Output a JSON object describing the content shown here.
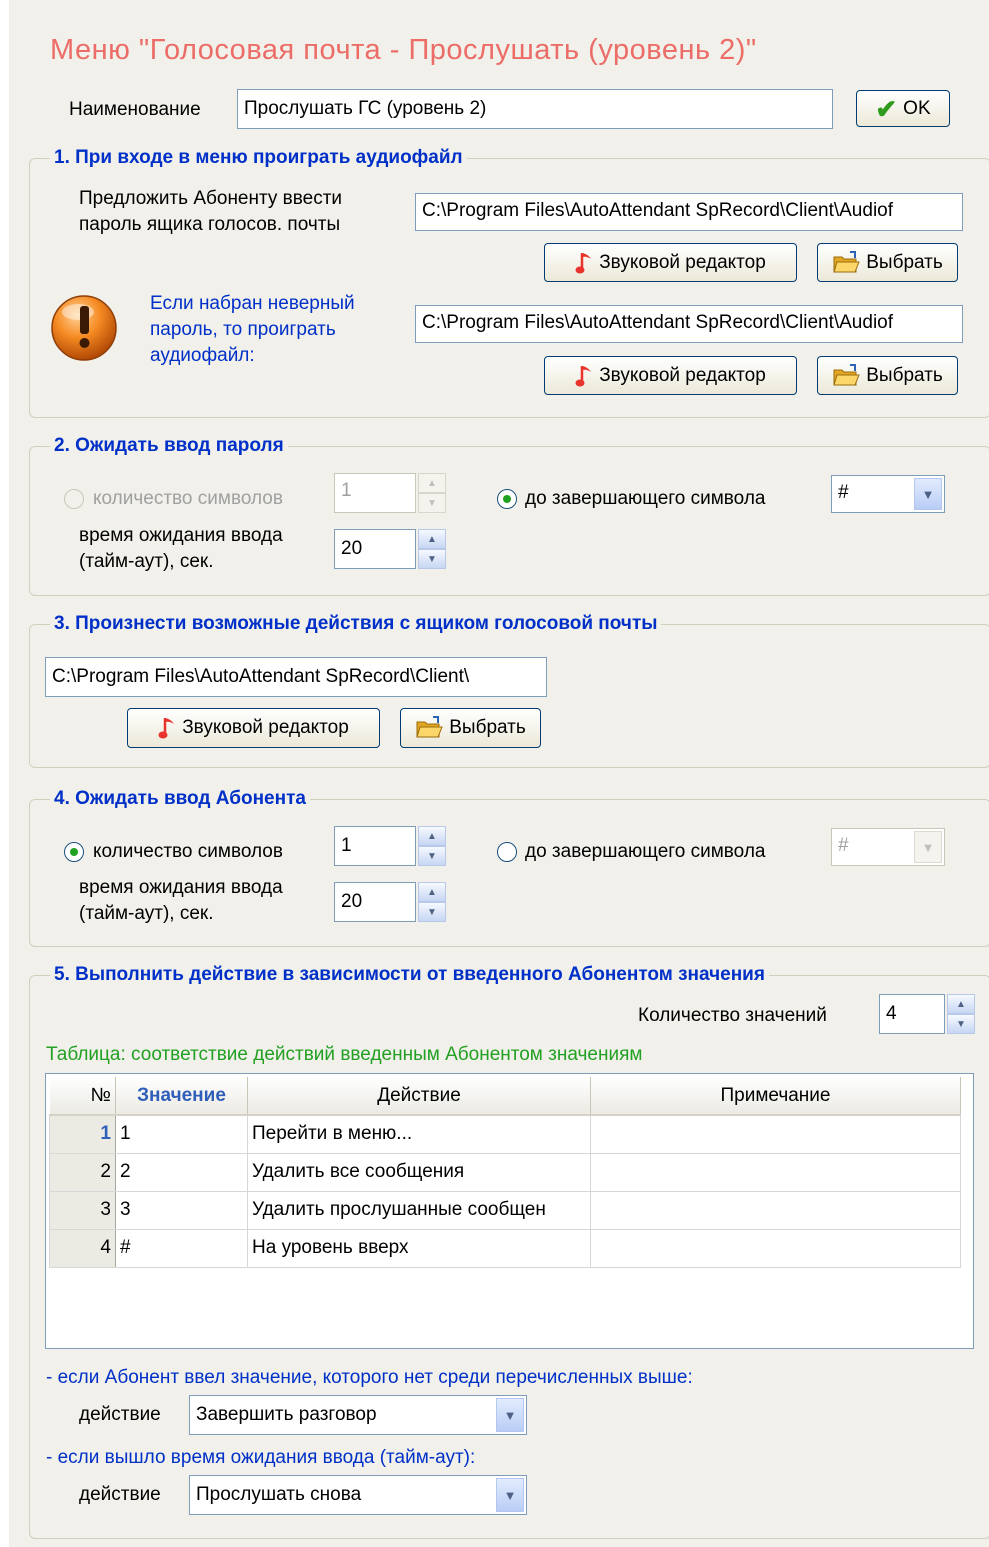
{
  "title": "Меню \"Голосовая почта - Прослушать (уровень 2)\"",
  "name_label": "Наименование",
  "name_value": "Прослушать ГС (уровень 2)",
  "ok_label": "OK",
  "sections": {
    "s1": {
      "legend": "1. При входе в меню проиграть аудиофайл",
      "prompt_line1": "Предложить Абоненту ввести",
      "prompt_line2": "пароль ящика голосов. почты",
      "file1": "C:\\Program Files\\AutoAttendant SpRecord\\Client\\Audiof",
      "wrong_line1": "Если набран неверный",
      "wrong_line2": "пароль, то проиграть",
      "wrong_line3": "аудиофайл:",
      "file2": "C:\\Program Files\\AutoAttendant SpRecord\\Client\\Audiof"
    },
    "s2": {
      "legend": "2. Ожидать ввод пароля",
      "count_label": "количество символов",
      "count_value": "1",
      "term_label": "до завершающего символа",
      "term_value": "#",
      "timeout_line1": "время ожидания ввода",
      "timeout_line2": "(тайм-аут), сек.",
      "timeout_value": "20"
    },
    "s3": {
      "legend": "3. Произнести возможные действия с ящиком голосовой почты",
      "file": "C:\\Program Files\\AutoAttendant SpRecord\\Client\\"
    },
    "s4": {
      "legend": "4. Ожидать ввод Абонента",
      "count_label": "количество символов",
      "count_value": "1",
      "term_label": "до завершающего символа",
      "term_value": "#",
      "timeout_line1": "время ожидания ввода",
      "timeout_line2": "(тайм-аут), сек.",
      "timeout_value": "20"
    },
    "s5": {
      "legend": "5. Выполнить действие в зависимости от введенного Абонентом значения",
      "count_label": "Количество значений",
      "count_value": "4",
      "table_caption": "Таблица: соответствие действий введенным Абонентом значениям",
      "columns": [
        "№",
        "Значение",
        "Действие",
        "Примечание"
      ],
      "rows": [
        {
          "num": "1",
          "value": "1",
          "action": "Перейти в меню...",
          "note": ""
        },
        {
          "num": "2",
          "value": "2",
          "action": "Удалить все сообщения",
          "note": ""
        },
        {
          "num": "3",
          "value": "3",
          "action": "Удалить прослушанные сообщен",
          "note": ""
        },
        {
          "num": "4",
          "value": "#",
          "action": "На уровень вверх",
          "note": ""
        }
      ],
      "invalid_caption": "- если Абонент ввел значение, которого нет среди перечисленных выше:",
      "invalid_action_label": "действие",
      "invalid_action_value": "Завершить разговор",
      "timeout_caption": "- если вышло время ожидания ввода (тайм-аут):",
      "timeout_action_label": "действие",
      "timeout_action_value": "Прослушать снова"
    }
  },
  "buttons": {
    "sound_editor": "Звуковой редактор",
    "choose": "Выбрать"
  },
  "colors": {
    "title": "#ec6d67",
    "legend": "#0030c8",
    "caption_green": "#22a022",
    "panel": "#f1f0ea"
  }
}
